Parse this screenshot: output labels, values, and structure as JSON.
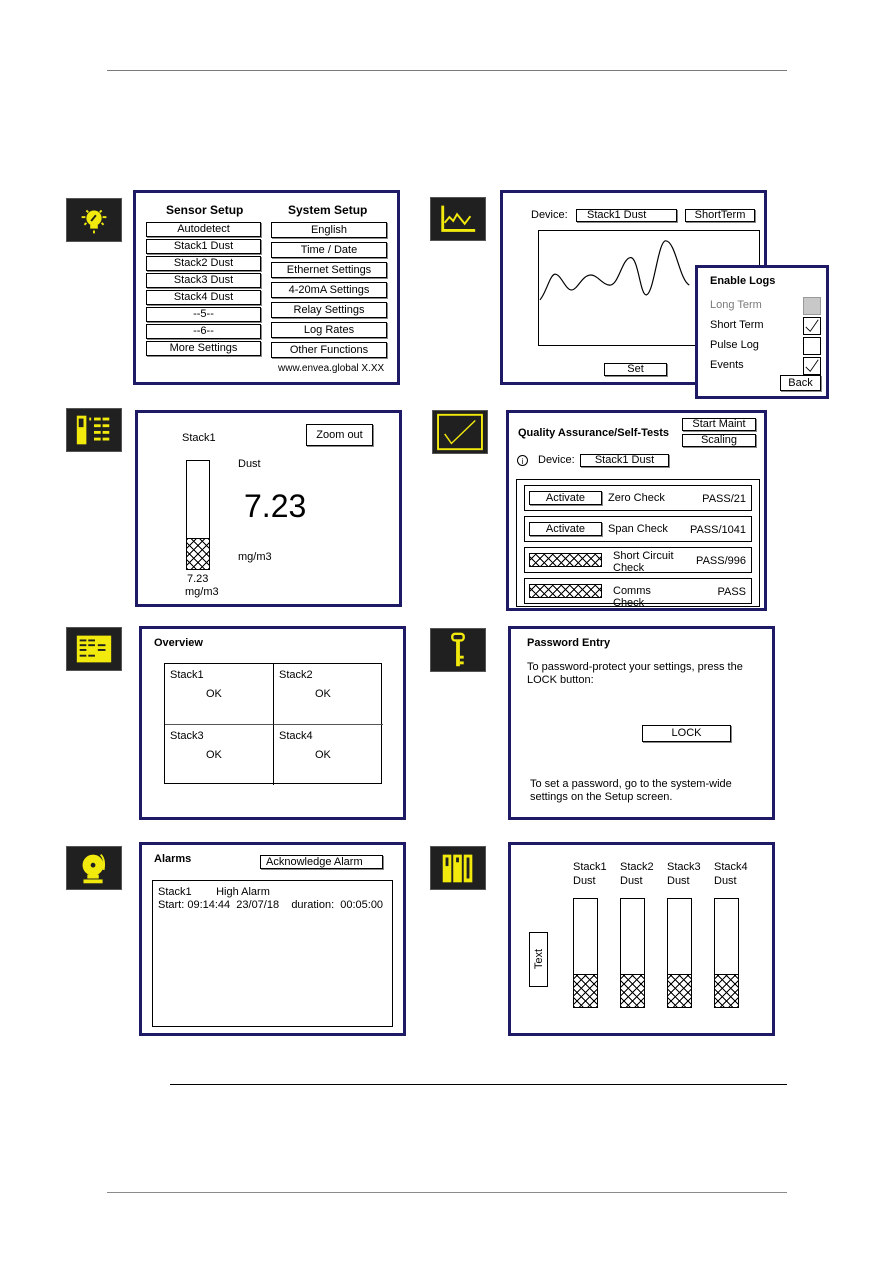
{
  "colors": {
    "panel_border": "#1e1a66",
    "icon_bg": "#202020",
    "icon_fg": "#f2ea0d",
    "disabled_text": "#7a7a7a"
  },
  "setup": {
    "icon": "lightbulb-wrench-icon",
    "sensor_title": "Sensor Setup",
    "system_title": "System Setup",
    "sensor_items": [
      "Autodetect",
      "Stack1 Dust",
      "Stack2 Dust",
      "Stack3 Dust",
      "Stack4 Dust",
      "--5--",
      "--6--",
      "More Settings"
    ],
    "system_items": [
      "English",
      "Time / Date",
      "Ethernet Settings",
      "4-20mA Settings",
      "Relay Settings",
      "Log Rates",
      "Other Functions"
    ],
    "footer": "www.envea.global  X.XX"
  },
  "trend": {
    "icon": "line-chart-icon",
    "device_label": "Device:",
    "device_value": "Stack1 Dust",
    "range_value": "ShortTerm",
    "set_label": "Set",
    "logs": {
      "title": "Enable Logs",
      "items": [
        {
          "label": "Long Term",
          "checked": false,
          "disabled": true
        },
        {
          "label": "Short Term",
          "checked": true,
          "disabled": false
        },
        {
          "label": "Pulse Log",
          "checked": false,
          "disabled": false
        },
        {
          "label": "Events",
          "checked": true,
          "disabled": false
        }
      ],
      "back_label": "Back"
    }
  },
  "zoomed": {
    "icon": "single-bar-list-icon",
    "stack_label": "Stack1",
    "zoom_out_label": "Zoom out",
    "measure_label": "Dust",
    "value": "7.23",
    "unit": "mg/m3",
    "bar_value": "7.23",
    "bar_unit": "mg/m3",
    "bar_fill_fraction": 0.28
  },
  "qa": {
    "icon": "checkmark-icon",
    "title": "Quality Assurance/Self-Tests",
    "start_maint_label": "Start Maint",
    "scaling_label": "Scaling",
    "info_icon": "info-icon",
    "device_label": "Device:",
    "device_value": "Stack1 Dust",
    "tests": [
      {
        "action": "Activate",
        "name": "Zero Check",
        "result": "PASS/21",
        "disabled": false
      },
      {
        "action": "Activate",
        "name": "Span Check",
        "result": "PASS/1041",
        "disabled": false
      },
      {
        "action": "",
        "name": "Short Circuit Check",
        "result": "PASS/996",
        "disabled": true
      },
      {
        "action": "",
        "name": "Comms Check",
        "result": "PASS",
        "disabled": true
      }
    ]
  },
  "overview": {
    "icon": "overview-grid-icon",
    "title": "Overview",
    "cells": [
      {
        "name": "Stack1",
        "status": "OK"
      },
      {
        "name": "Stack2",
        "status": "OK"
      },
      {
        "name": "Stack3",
        "status": "OK"
      },
      {
        "name": "Stack4",
        "status": "OK"
      }
    ]
  },
  "password": {
    "icon": "key-icon",
    "title": "Password Entry",
    "instruction": "To password-protect your settings, press the LOCK button:",
    "lock_label": "LOCK",
    "note": "To set a password, go to the system-wide settings on the Setup screen."
  },
  "alarms": {
    "icon": "bell-icon",
    "title": "Alarms",
    "ack_label": "Acknowledge Alarm",
    "entries": [
      {
        "line1": "Stack1        High Alarm",
        "line2": "Start: 09:14:44  23/07/18    duration:  00:05:00"
      }
    ]
  },
  "bars": {
    "icon": "multi-bar-icon",
    "side_label": "Text",
    "stacks": [
      {
        "name": "Stack1",
        "measure": "Dust",
        "fill_fraction": 0.3
      },
      {
        "name": "Stack2",
        "measure": "Dust",
        "fill_fraction": 0.3
      },
      {
        "name": "Stack3",
        "measure": "Dust",
        "fill_fraction": 0.3
      },
      {
        "name": "Stack4",
        "measure": "Dust",
        "fill_fraction": 0.3
      }
    ]
  }
}
